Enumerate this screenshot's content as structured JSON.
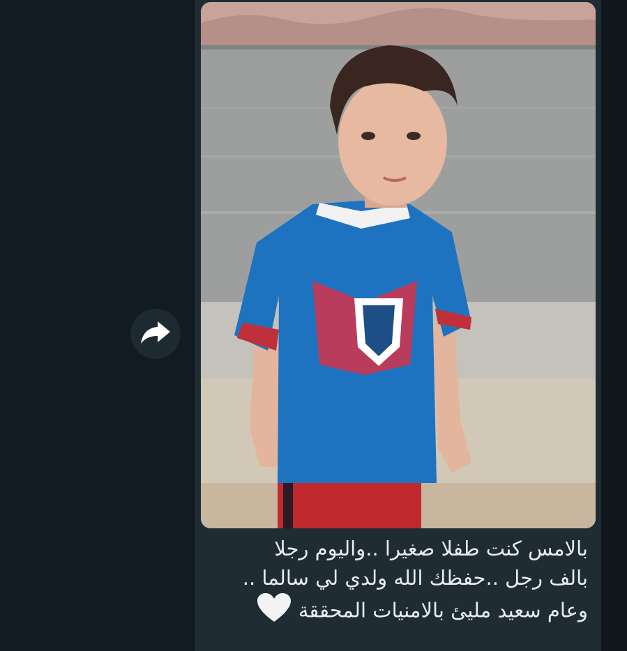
{
  "chat": {
    "forward_icon": "forward-arrow-icon",
    "message": {
      "image": {
        "description_icon": "photo-child-on-beach"
      },
      "caption_lines": [
        "بالامس كنت طفلا صغيرا ..واليوم رجلا",
        "بالف رجل ..حفظك الله ولدي لي سالما ..",
        "وعام سعيد مليئ بالامنيات المحققة"
      ],
      "caption_emoji": "white-heart-icon"
    }
  },
  "colors": {
    "background": "#111b21",
    "bubble": "#1f2c33",
    "text": "#e9edef",
    "forward_button": "#1e2a31"
  }
}
